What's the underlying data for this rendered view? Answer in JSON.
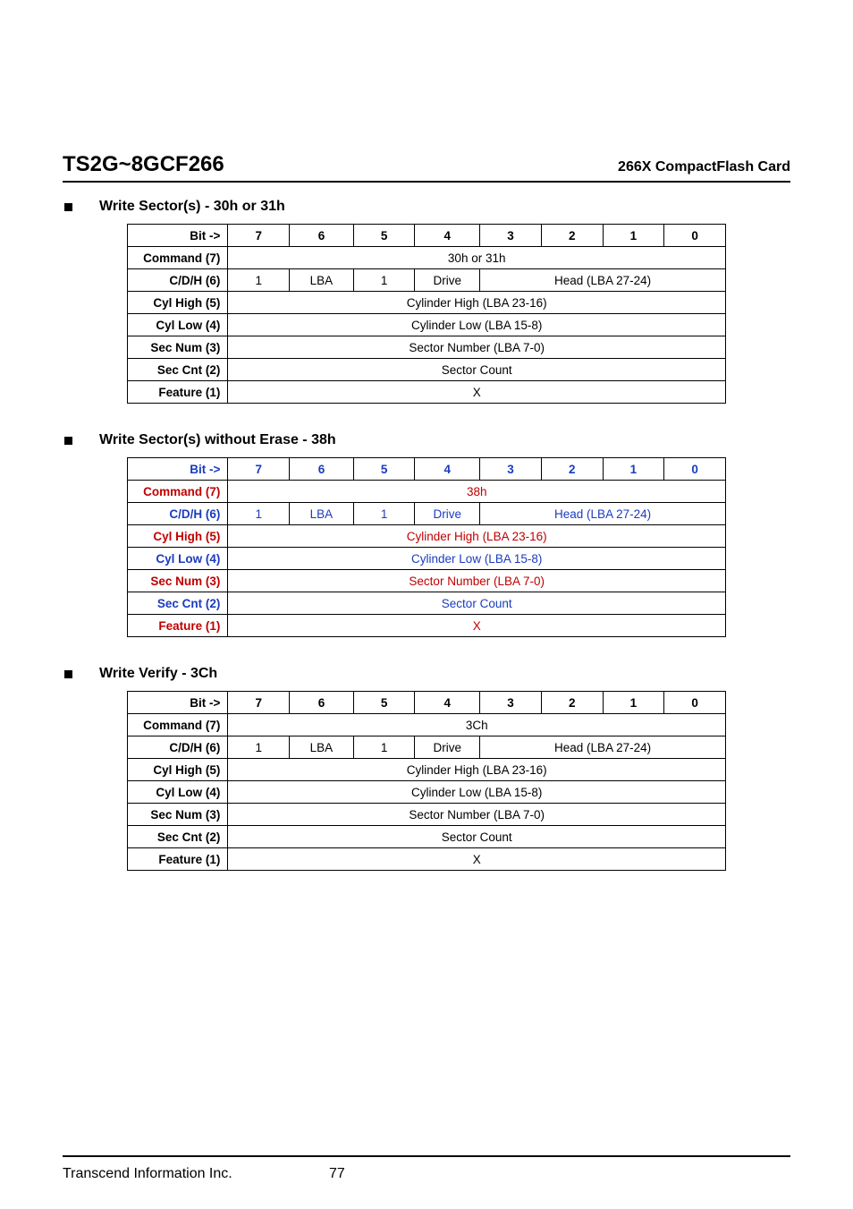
{
  "header": {
    "product": "TS2G~8GCF266",
    "subtitle": "266X CompactFlash Card"
  },
  "sections": [
    {
      "title": "Write Sector(s) - 30h or 31h",
      "color": "black",
      "rows": {
        "bit_label": "Bit ->",
        "bits": [
          "7",
          "6",
          "5",
          "4",
          "3",
          "2",
          "1",
          "0"
        ],
        "command_label": "Command (7)",
        "command_value": "30h or 31h",
        "cdh_label": "C/D/H (6)",
        "cdh_c7": "1",
        "cdh_lba": "LBA",
        "cdh_c5": "1",
        "cdh_drive": "Drive",
        "cdh_head": "Head (LBA 27-24)",
        "cylhigh_label": "Cyl High (5)",
        "cylhigh_value": "Cylinder High (LBA 23-16)",
        "cyllow_label": "Cyl Low (4)",
        "cyllow_value": "Cylinder Low (LBA 15-8)",
        "secnum_label": "Sec Num (3)",
        "secnum_value": "Sector Number (LBA 7-0)",
        "seccnt_label": "Sec Cnt (2)",
        "seccnt_value": "Sector Count",
        "feature_label": "Feature (1)",
        "feature_value": "X"
      }
    },
    {
      "title": "Write Sector(s) without Erase - 38h",
      "color": "mixed",
      "rows": {
        "bit_label": "Bit ->",
        "bits": [
          "7",
          "6",
          "5",
          "4",
          "3",
          "2",
          "1",
          "0"
        ],
        "command_label": "Command (7)",
        "command_value": "38h",
        "cdh_label": "C/D/H (6)",
        "cdh_c7": "1",
        "cdh_lba": "LBA",
        "cdh_c5": "1",
        "cdh_drive": "Drive",
        "cdh_head": "Head (LBA 27-24)",
        "cylhigh_label": "Cyl High (5)",
        "cylhigh_value": "Cylinder High (LBA 23-16)",
        "cyllow_label": "Cyl Low (4)",
        "cyllow_value": "Cylinder Low (LBA 15-8)",
        "secnum_label": "Sec Num (3)",
        "secnum_value": "Sector Number (LBA 7-0)",
        "seccnt_label": "Sec Cnt (2)",
        "seccnt_value": "Sector Count",
        "feature_label": "Feature (1)",
        "feature_value": "X"
      }
    },
    {
      "title": "Write Verify - 3Ch",
      "color": "black",
      "rows": {
        "bit_label": "Bit ->",
        "bits": [
          "7",
          "6",
          "5",
          "4",
          "3",
          "2",
          "1",
          "0"
        ],
        "command_label": "Command (7)",
        "command_value": "3Ch",
        "cdh_label": "C/D/H (6)",
        "cdh_c7": "1",
        "cdh_lba": "LBA",
        "cdh_c5": "1",
        "cdh_drive": "Drive",
        "cdh_head": "Head (LBA 27-24)",
        "cylhigh_label": "Cyl High (5)",
        "cylhigh_value": "Cylinder High (LBA 23-16)",
        "cyllow_label": "Cyl Low (4)",
        "cyllow_value": "Cylinder Low (LBA 15-8)",
        "secnum_label": "Sec Num (3)",
        "secnum_value": "Sector Number (LBA 7-0)",
        "seccnt_label": "Sec Cnt (2)",
        "seccnt_value": "Sector Count",
        "feature_label": "Feature (1)",
        "feature_value": "X"
      }
    }
  ],
  "footer": {
    "company": "Transcend Information Inc.",
    "page": "77"
  }
}
